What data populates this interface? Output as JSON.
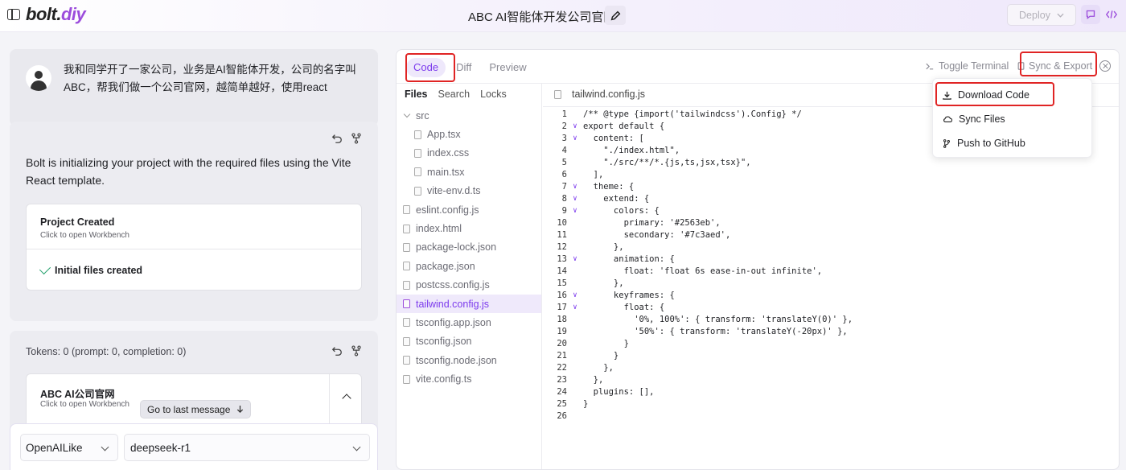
{
  "header": {
    "logo_main": "bolt.",
    "logo_accent": "diy",
    "project_title": "ABC AI智能体开发公司官网",
    "deploy_label": "Deploy"
  },
  "chat": {
    "user_message": "我和同学开了一家公司，业务是AI智能体开发，公司的名字叫ABC，帮我们做一个公司官网，越简单越好，使用react",
    "bot_message": "Bolt is initializing your project with the required files using the Vite React template.",
    "artifact1": {
      "title": "Project Created",
      "subtitle": "Click to open Workbench",
      "step": "Initial files created"
    },
    "tokens": "Tokens: 0 (prompt: 0, completion: 0)",
    "artifact2": {
      "title": "ABC AI公司官网",
      "subtitle": "Click to open Workbench"
    },
    "go_last_label": "Go to last message",
    "provider": "OpenAILike",
    "model": "deepseek-r1"
  },
  "workbench": {
    "tabs": [
      "Code",
      "Diff",
      "Preview"
    ],
    "toggle_terminal": "Toggle Terminal",
    "sync_export": "Sync & Export",
    "panel_tabs": [
      "Files",
      "Search",
      "Locks"
    ],
    "folder": "src",
    "src_files": [
      "App.tsx",
      "index.css",
      "main.tsx",
      "vite-env.d.ts"
    ],
    "root_files": [
      "eslint.config.js",
      "index.html",
      "package-lock.json",
      "package.json",
      "postcss.config.js",
      "tailwind.config.js",
      "tsconfig.app.json",
      "tsconfig.json",
      "tsconfig.node.json",
      "vite.config.ts"
    ],
    "selected_file": "tailwind.config.js",
    "editor_tab": "tailwind.config.js",
    "code_lines": [
      "/** @type {import('tailwindcss').Config} */",
      "export default {",
      "  content: [",
      "    \"./index.html\",",
      "    \"./src/**/*.{js,ts,jsx,tsx}\",",
      "  ],",
      "  theme: {",
      "    extend: {",
      "      colors: {",
      "        primary: '#2563eb',",
      "        secondary: '#7c3aed',",
      "      },",
      "      animation: {",
      "        float: 'float 6s ease-in-out infinite',",
      "      },",
      "      keyframes: {",
      "        float: {",
      "          '0%, 100%': { transform: 'translateY(0)' },",
      "          '50%': { transform: 'translateY(-20px)' },",
      "        }",
      "      }",
      "    },",
      "  },",
      "  plugins: [],",
      "}",
      ""
    ],
    "fold_lines": [
      2,
      3,
      7,
      8,
      9,
      13,
      16,
      17
    ]
  },
  "dropdown": {
    "items": [
      "Download Code",
      "Sync Files",
      "Push to GitHub"
    ]
  },
  "colors": {
    "accent": "#7c3aed",
    "logo_accent": "#9c4ddc",
    "highlight": "#e02424"
  }
}
